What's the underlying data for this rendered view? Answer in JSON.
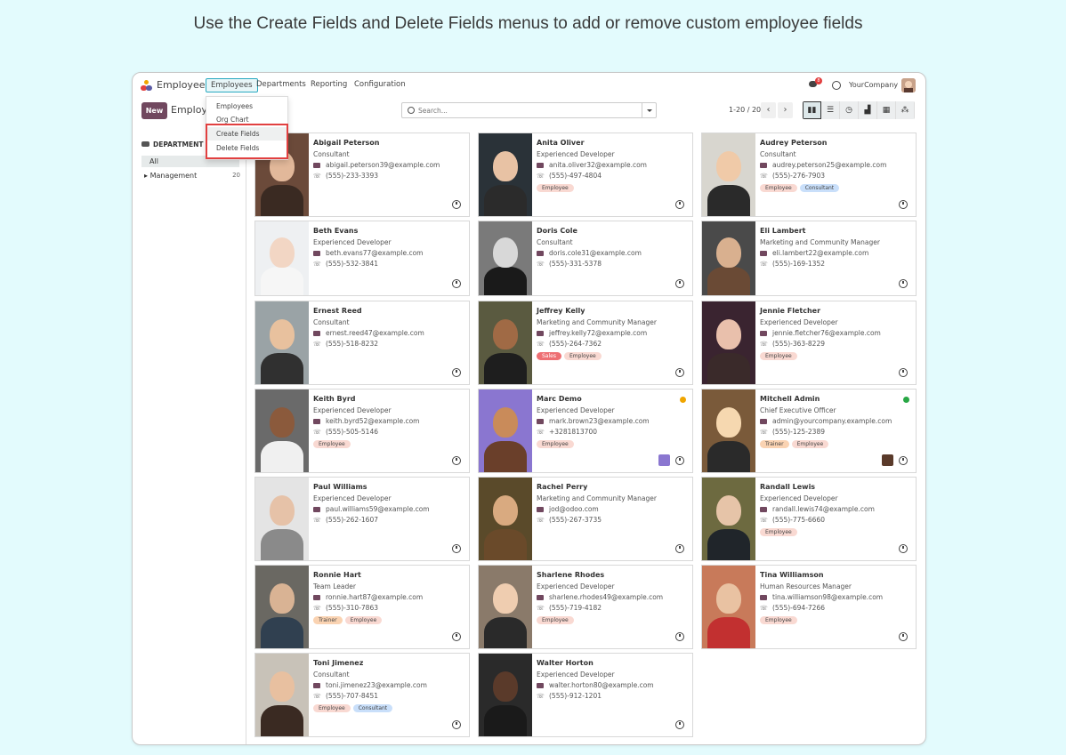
{
  "caption": "Use the Create Fields and Delete Fields menus to add or remove custom employee fields",
  "navbar": {
    "app_name": "Employees",
    "menu": [
      "Employees",
      "Departments",
      "Reporting",
      "Configuration"
    ],
    "chat_badge": "8",
    "company": "YourCompany"
  },
  "control": {
    "new_label": "New",
    "breadcrumb": "Employees",
    "search_placeholder": "Search...",
    "pager": "1-20 / 20"
  },
  "dropdown": {
    "items": [
      "Employees",
      "Org Chart",
      "Create Fields",
      "Delete Fields"
    ]
  },
  "sidebar": {
    "title": "DEPARTMENT",
    "all": "All",
    "management": "Management",
    "management_count": "20"
  },
  "colors": {
    "accent": "#71485f",
    "highlight": "#e14040",
    "online": "#28a745",
    "away": "#f0a500"
  },
  "employees": [
    {
      "name": "Abigail Peterson",
      "job": "Consultant",
      "email": "abigail.peterson39@example.com",
      "phone": "(555)-233-3393",
      "tags": []
    },
    {
      "name": "Anita Oliver",
      "job": "Experienced Developer",
      "email": "anita.oliver32@example.com",
      "phone": "(555)-497-4804",
      "tags": [
        "Employee"
      ]
    },
    {
      "name": "Audrey Peterson",
      "job": "Consultant",
      "email": "audrey.peterson25@example.com",
      "phone": "(555)-276-7903",
      "tags": [
        "Employee",
        "Consultant"
      ]
    },
    {
      "name": "Beth Evans",
      "job": "Experienced Developer",
      "email": "beth.evans77@example.com",
      "phone": "(555)-532-3841",
      "tags": []
    },
    {
      "name": "Doris Cole",
      "job": "Consultant",
      "email": "doris.cole31@example.com",
      "phone": "(555)-331-5378",
      "tags": []
    },
    {
      "name": "Eli Lambert",
      "job": "Marketing and Community Manager",
      "email": "eli.lambert22@example.com",
      "phone": "(555)-169-1352",
      "tags": []
    },
    {
      "name": "Ernest Reed",
      "job": "Consultant",
      "email": "ernest.reed47@example.com",
      "phone": "(555)-518-8232",
      "tags": []
    },
    {
      "name": "Jeffrey Kelly",
      "job": "Marketing and Community Manager",
      "email": "jeffrey.kelly72@example.com",
      "phone": "(555)-264-7362",
      "tags": [
        "Sales",
        "Employee"
      ]
    },
    {
      "name": "Jennie Fletcher",
      "job": "Experienced Developer",
      "email": "jennie.fletcher76@example.com",
      "phone": "(555)-363-8229",
      "tags": [
        "Employee"
      ]
    },
    {
      "name": "Keith Byrd",
      "job": "Experienced Developer",
      "email": "keith.byrd52@example.com",
      "phone": "(555)-505-5146",
      "tags": [
        "Employee"
      ]
    },
    {
      "name": "Marc Demo",
      "job": "Experienced Developer",
      "email": "mark.brown23@example.com",
      "phone": "+3281813700",
      "tags": [
        "Employee"
      ],
      "status": "away"
    },
    {
      "name": "Mitchell Admin",
      "job": "Chief Executive Officer",
      "email": "admin@yourcompany.example.com",
      "phone": "(555)-125-2389",
      "tags": [
        "Trainer",
        "Employee"
      ],
      "status": "online"
    },
    {
      "name": "Paul Williams",
      "job": "Experienced Developer",
      "email": "paul.williams59@example.com",
      "phone": "(555)-262-1607",
      "tags": []
    },
    {
      "name": "Rachel Perry",
      "job": "Marketing and Community Manager",
      "email": "jod@odoo.com",
      "phone": "(555)-267-3735",
      "tags": []
    },
    {
      "name": "Randall Lewis",
      "job": "Experienced Developer",
      "email": "randall.lewis74@example.com",
      "phone": "(555)-775-6660",
      "tags": [
        "Employee"
      ]
    },
    {
      "name": "Ronnie Hart",
      "job": "Team Leader",
      "email": "ronnie.hart87@example.com",
      "phone": "(555)-310-7863",
      "tags": [
        "Trainer",
        "Employee"
      ]
    },
    {
      "name": "Sharlene Rhodes",
      "job": "Experienced Developer",
      "email": "sharlene.rhodes49@example.com",
      "phone": "(555)-719-4182",
      "tags": [
        "Employee"
      ]
    },
    {
      "name": "Tina Williamson",
      "job": "Human Resources Manager",
      "email": "tina.williamson98@example.com",
      "phone": "(555)-694-7266",
      "tags": [
        "Employee"
      ]
    },
    {
      "name": "Toni Jimenez",
      "job": "Consultant",
      "email": "toni.jimenez23@example.com",
      "phone": "(555)-707-8451",
      "tags": [
        "Employee",
        "Consultant"
      ]
    },
    {
      "name": "Walter Horton",
      "job": "Experienced Developer",
      "email": "walter.horton80@example.com",
      "phone": "(555)-912-1201",
      "tags": []
    }
  ]
}
